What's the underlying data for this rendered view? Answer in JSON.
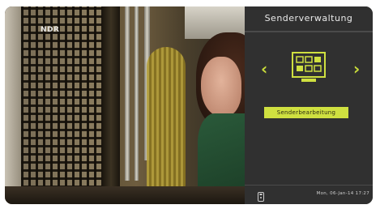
{
  "video": {
    "channel_logo": "NDR"
  },
  "menu": {
    "title": "Senderverwaltung",
    "nav_left": "‹",
    "nav_right": "›",
    "current_icon": "channel-grid-icon",
    "options": [
      {
        "label": "Senderbearbeitung",
        "selected": true
      }
    ],
    "footer": {
      "remote_icon": "remote-control-icon",
      "datetime": "Mon, 06-Jan-14 17:27"
    }
  },
  "colors": {
    "accent": "#cfe040",
    "panel_bg": "#303030",
    "header_text": "#eaeaea"
  }
}
